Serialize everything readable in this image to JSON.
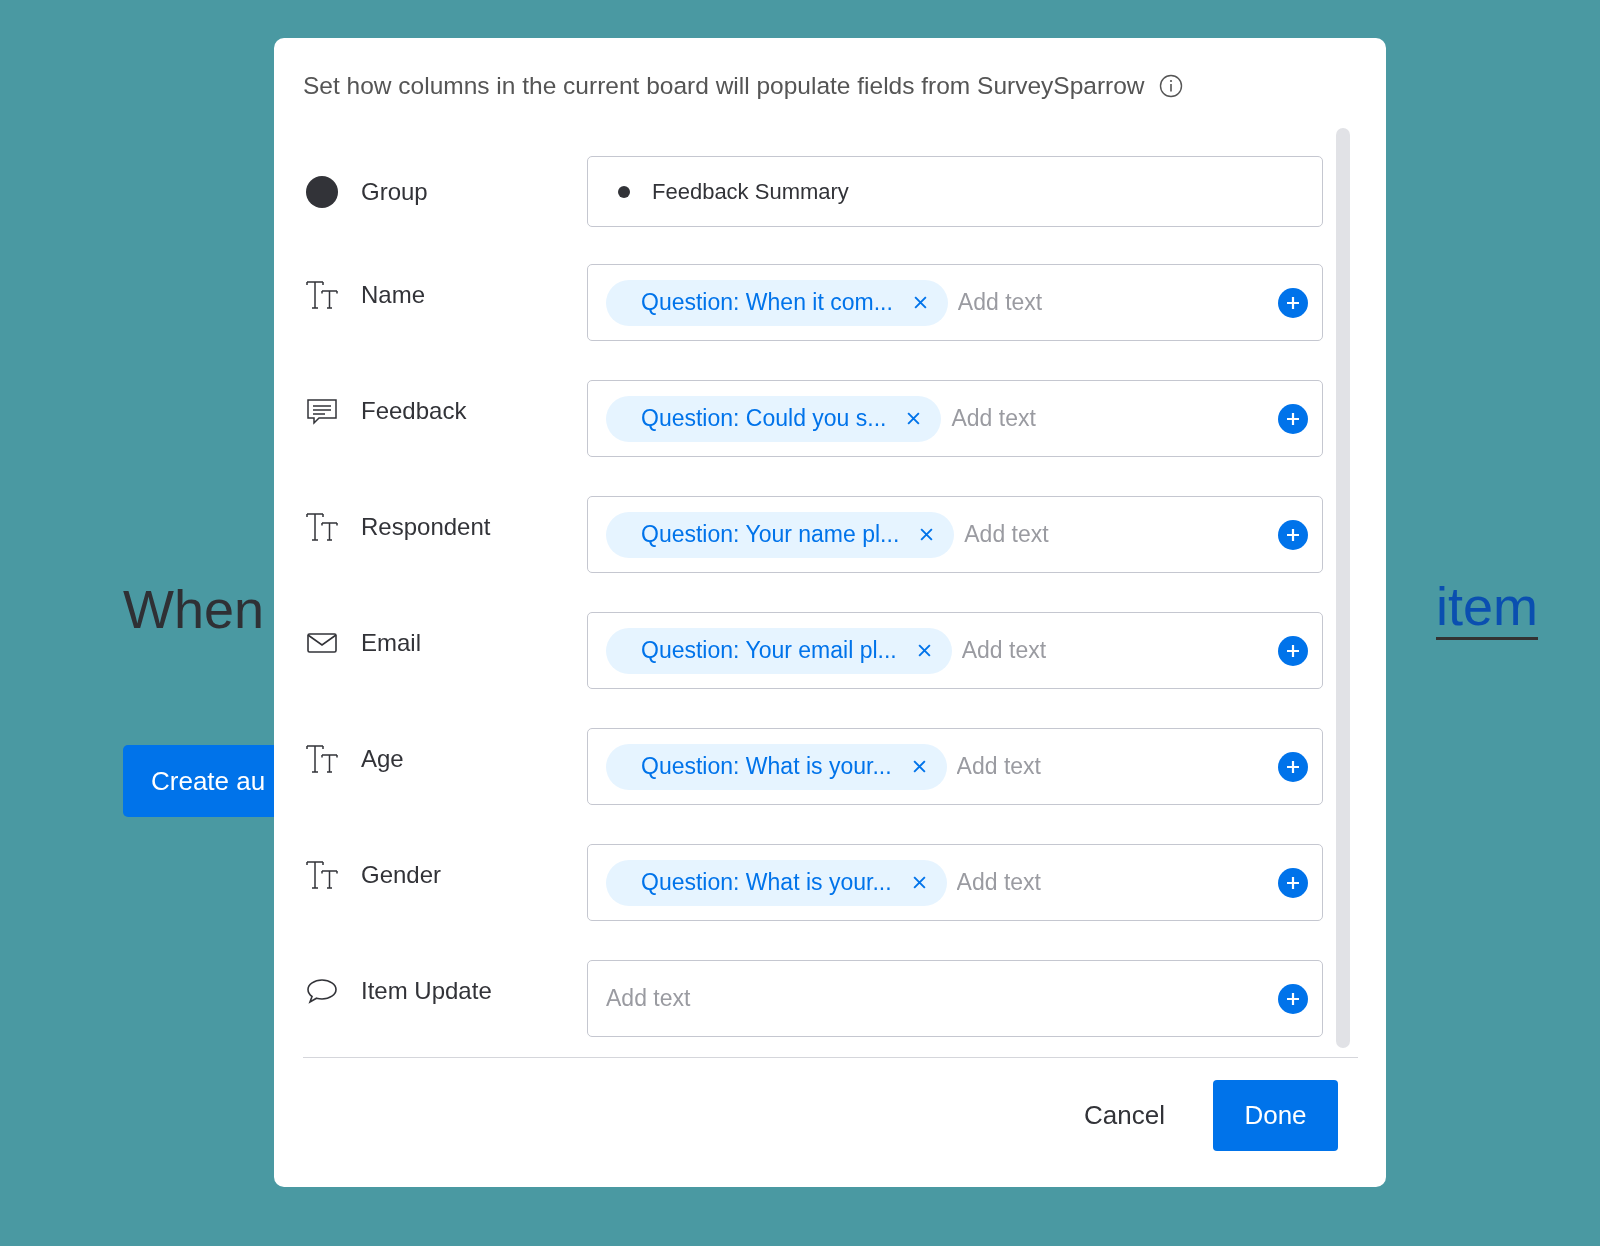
{
  "background": {
    "heading_start": "When",
    "heading_link": "item",
    "button": "Create au"
  },
  "dialog": {
    "description": "Set how columns in the current board will populate fields from SurveySparrow",
    "rows": [
      {
        "kind": "group",
        "label": "Group",
        "value": "Feedback Summary"
      },
      {
        "kind": "text",
        "label": "Name",
        "chip": "Question: When it com...",
        "placeholder": "Add text"
      },
      {
        "kind": "long_text",
        "label": "Feedback",
        "chip": "Question: Could you s...",
        "placeholder": "Add text"
      },
      {
        "kind": "text",
        "label": "Respondent",
        "chip": "Question: Your name pl...",
        "placeholder": "Add text"
      },
      {
        "kind": "email",
        "label": "Email",
        "chip": "Question: Your email pl...",
        "placeholder": "Add text"
      },
      {
        "kind": "text",
        "label": "Age",
        "chip": "Question: What is your...",
        "placeholder": "Add text"
      },
      {
        "kind": "text",
        "label": "Gender",
        "chip": "Question: What is your...",
        "placeholder": "Add text"
      },
      {
        "kind": "update",
        "label": "Item Update",
        "placeholder": "Add text"
      }
    ],
    "buttons": {
      "cancel": "Cancel",
      "done": "Done"
    }
  }
}
